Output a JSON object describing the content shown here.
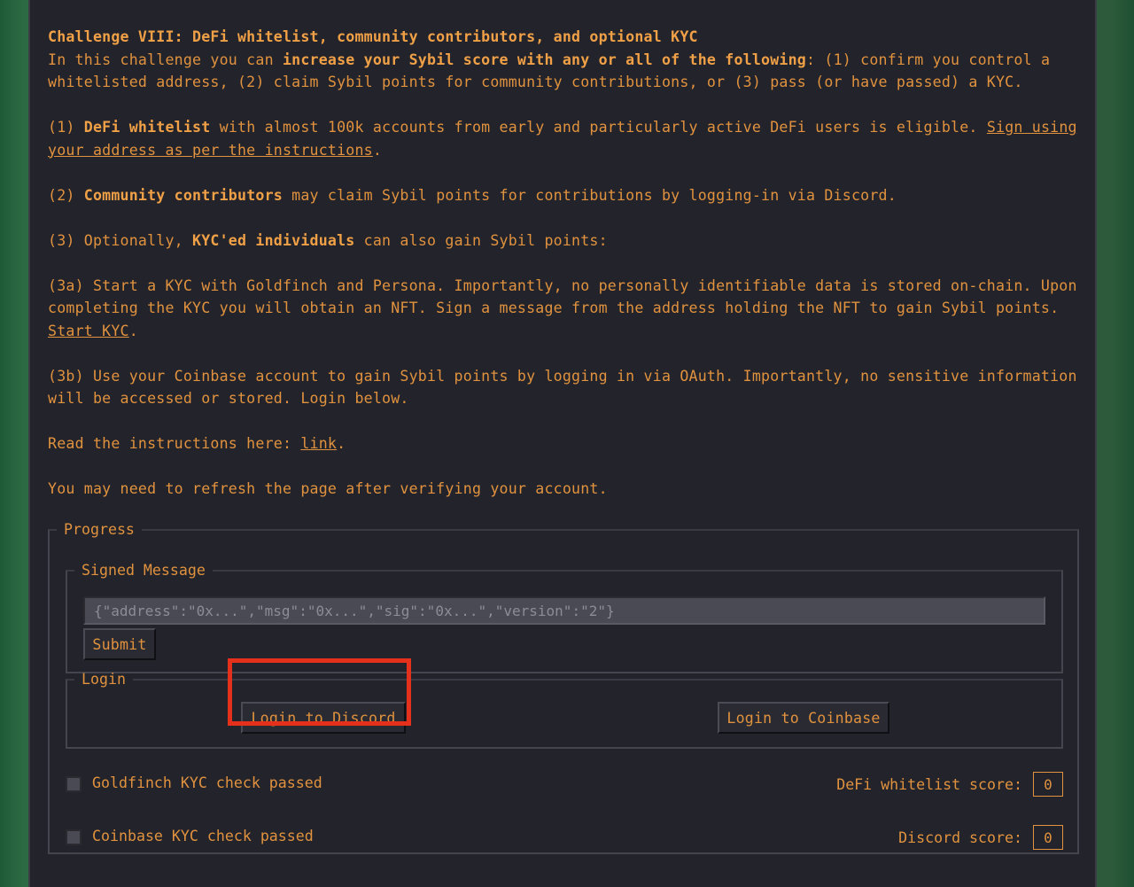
{
  "intro": {
    "title": "Challenge VIII: DeFi whitelist, community contributors, and optional KYC",
    "line_a": "In this challenge you can ",
    "line_bold": "increase your Sybil score with any or all of the following",
    "line_b": ": (1) confirm you control a whitelisted address, (2) claim Sybil points for community contributions, or (3) pass (or have passed) a KYC."
  },
  "item1": {
    "prefix": "(1) ",
    "bold": "DeFi whitelist",
    "text": " with almost 100k accounts from early and particularly active DeFi users is eligible. ",
    "link": "Sign using your address as per the instructions",
    "suffix": "."
  },
  "item2": {
    "prefix": "(2) ",
    "bold": "Community contributors",
    "text": " may claim Sybil points for contributions by logging-in via Discord."
  },
  "item3": {
    "prefix": "(3) Optionally, ",
    "bold": "KYC'ed individuals",
    "text": " can also gain Sybil points:"
  },
  "item3a": {
    "text": "(3a) Start a KYC with Goldfinch and Persona. Importantly, no personally identifiable data is stored on-chain. Upon completing the KYC you will obtain an NFT. Sign a message from the address holding the NFT to gain Sybil points. ",
    "link": "Start KYC",
    "suffix": "."
  },
  "item3b": {
    "text": "(3b) Use your Coinbase account to gain Sybil points by logging in via OAuth. Importantly, no sensitive information will be accessed or stored. Login below."
  },
  "instructions": {
    "text": "Read the instructions here: ",
    "link": "link",
    "suffix": "."
  },
  "refresh_note": "You may need to refresh the page after verifying your account.",
  "progress": {
    "legend": "Progress",
    "signed_message": {
      "legend": "Signed Message",
      "placeholder": "{\"address\":\"0x...\",\"msg\":\"0x...\",\"sig\":\"0x...\",\"version\":\"2\"}",
      "submit_label": "Submit"
    },
    "login": {
      "legend": "Login",
      "discord_label": "Login to Discord",
      "coinbase_label": "Login to Coinbase"
    },
    "goldfinch_check_label": "Goldfinch KYC check passed",
    "coinbase_check_label": "Coinbase KYC check passed",
    "defi_score_label": "DeFi whitelist score:",
    "defi_score_value": "0",
    "discord_score_label": "Discord score:",
    "discord_score_value": "0"
  },
  "colors": {
    "text": "#e0923e",
    "panel": "#23232b",
    "highlight": "#e5301c"
  }
}
